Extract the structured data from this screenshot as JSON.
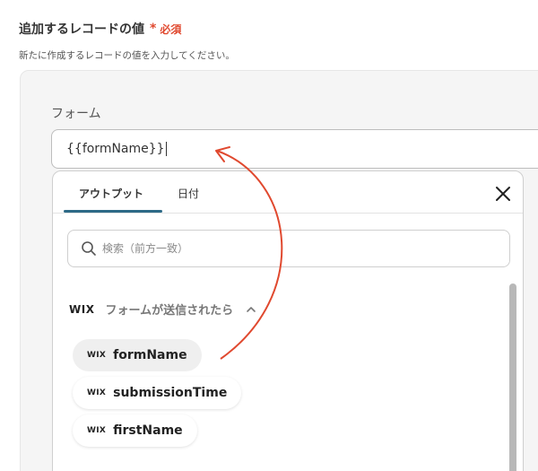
{
  "section": {
    "title": "追加するレコードの値",
    "required_mark": "*",
    "required_text": "必須",
    "description": "新たに作成するレコードの値を入力してください。"
  },
  "field": {
    "label": "フォーム",
    "value": "{{formName}}"
  },
  "dropdown": {
    "tabs": [
      {
        "label": "アウトプット",
        "active": true
      },
      {
        "label": "日付",
        "active": false
      }
    ],
    "search_placeholder": "検索（前方一致）",
    "group": {
      "logo": "WIX",
      "title": "フォームが送信されたら",
      "expanded": true
    },
    "items": [
      {
        "logo": "WIX",
        "label": "formName",
        "highlighted": true
      },
      {
        "logo": "WIX",
        "label": "submissionTime",
        "highlighted": false
      },
      {
        "logo": "WIX",
        "label": "firstName",
        "highlighted": false
      }
    ]
  },
  "colors": {
    "accent_tab": "#2d6a87",
    "required": "#e0492f",
    "annotation_arrow": "#e0492f"
  },
  "icons": {
    "close": "close-icon",
    "search": "search-icon",
    "chevron": "chevron-up-icon"
  }
}
